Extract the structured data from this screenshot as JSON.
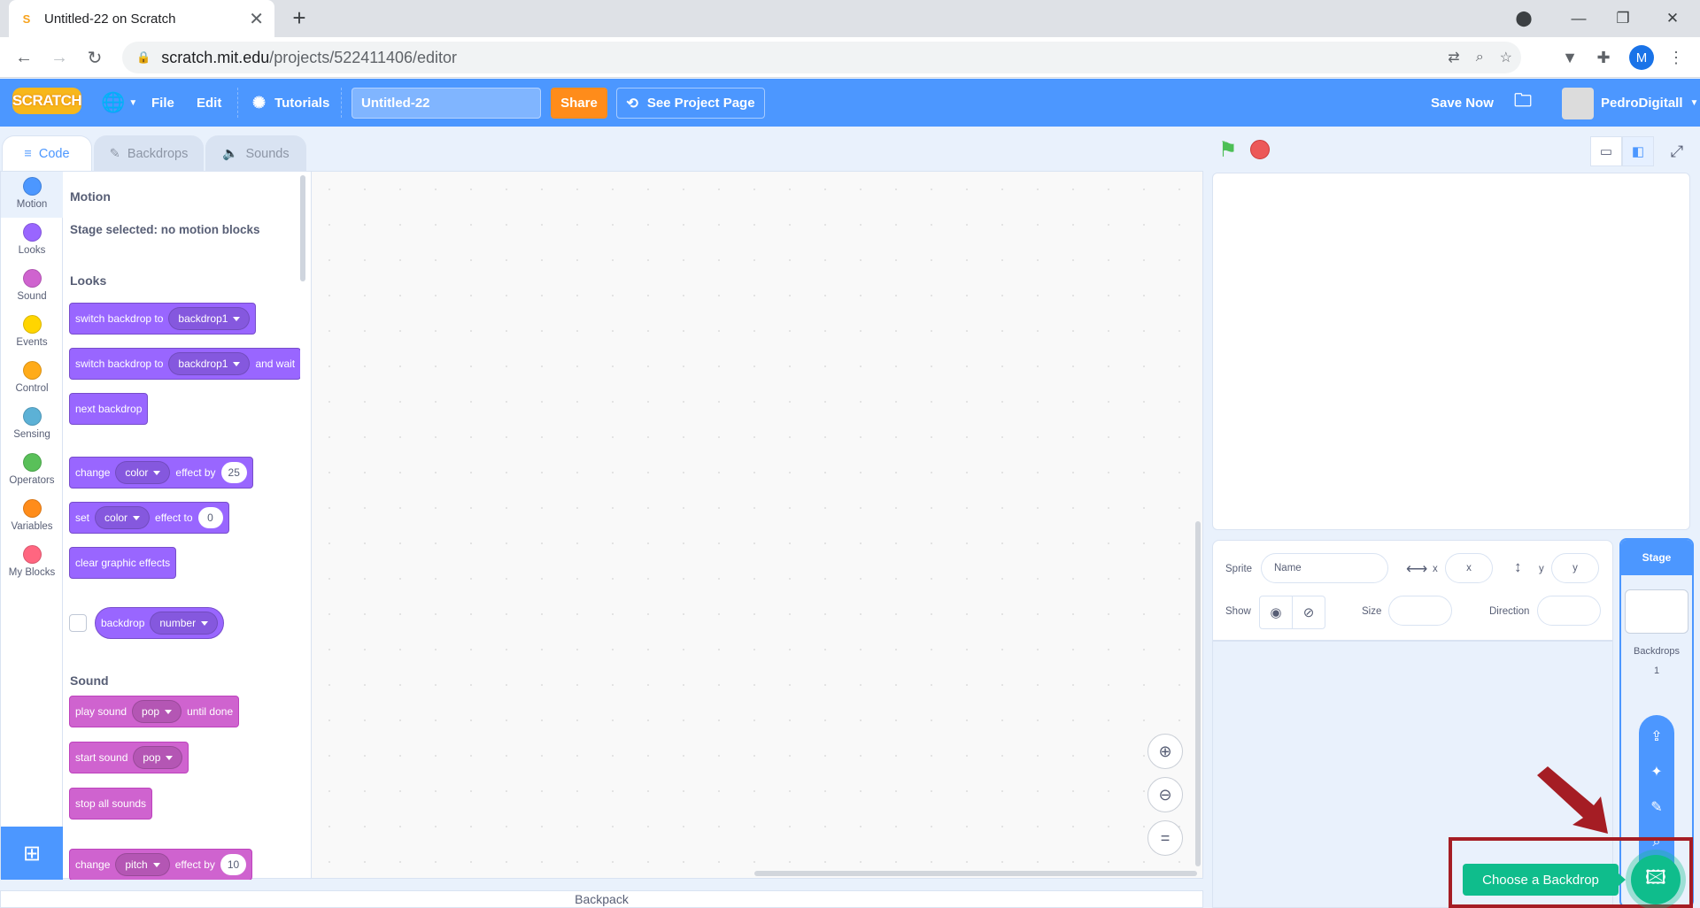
{
  "browser": {
    "tab_title": "Untitled-22 on Scratch",
    "favicon_letter": "S",
    "url_host": "scratch.mit.edu",
    "url_path": "/projects/522411406/editor",
    "profile_initial": "M"
  },
  "menubar": {
    "logo": "SCRATCH",
    "file": "File",
    "edit": "Edit",
    "tutorials": "Tutorials",
    "project_title": "Untitled-22",
    "share": "Share",
    "see_project_page": "See Project Page",
    "save_now": "Save Now",
    "username": "PedroDigitall"
  },
  "editor_tabs": {
    "code": "Code",
    "backdrops": "Backdrops",
    "sounds": "Sounds"
  },
  "categories": [
    {
      "label": "Motion",
      "color": "#4c97ff"
    },
    {
      "label": "Looks",
      "color": "#9966ff"
    },
    {
      "label": "Sound",
      "color": "#cf63cf"
    },
    {
      "label": "Events",
      "color": "#ffd500"
    },
    {
      "label": "Control",
      "color": "#ffab19"
    },
    {
      "label": "Sensing",
      "color": "#5cb1d6"
    },
    {
      "label": "Operators",
      "color": "#59c059"
    },
    {
      "label": "Variables",
      "color": "#ff8c1a"
    },
    {
      "label": "My Blocks",
      "color": "#ff6680"
    }
  ],
  "palette": {
    "motion_heading": "Motion",
    "motion_note": "Stage selected: no motion blocks",
    "looks_heading": "Looks",
    "sound_heading": "Sound",
    "looks": {
      "switch_backdrop_to": "switch backdrop to",
      "backdrop1": "backdrop1",
      "and_wait": "and wait",
      "next_backdrop": "next backdrop",
      "change": "change",
      "color": "color",
      "effect_by": "effect by",
      "effect_by_value": "25",
      "set": "set",
      "effect_to": "effect to",
      "effect_to_value": "0",
      "clear_graphic_effects": "clear graphic effects",
      "backdrop": "backdrop",
      "number": "number"
    },
    "sound": {
      "play_sound": "play sound",
      "pop": "pop",
      "until_done": "until done",
      "start_sound": "start sound",
      "stop_all_sounds": "stop all sounds",
      "change": "change",
      "pitch": "pitch",
      "effect_by": "effect by",
      "pitch_value": "10"
    }
  },
  "backpack": "Backpack",
  "sprite_info": {
    "sprite_label": "Sprite",
    "name_placeholder": "Name",
    "x_label": "x",
    "x_placeholder": "x",
    "y_label": "y",
    "y_placeholder": "y",
    "show_label": "Show",
    "size_label": "Size",
    "direction_label": "Direction"
  },
  "stage_selector": {
    "title": "Stage",
    "backdrops_label": "Backdrops",
    "backdrops_count": "1"
  },
  "tooltip": "Choose a Backdrop"
}
